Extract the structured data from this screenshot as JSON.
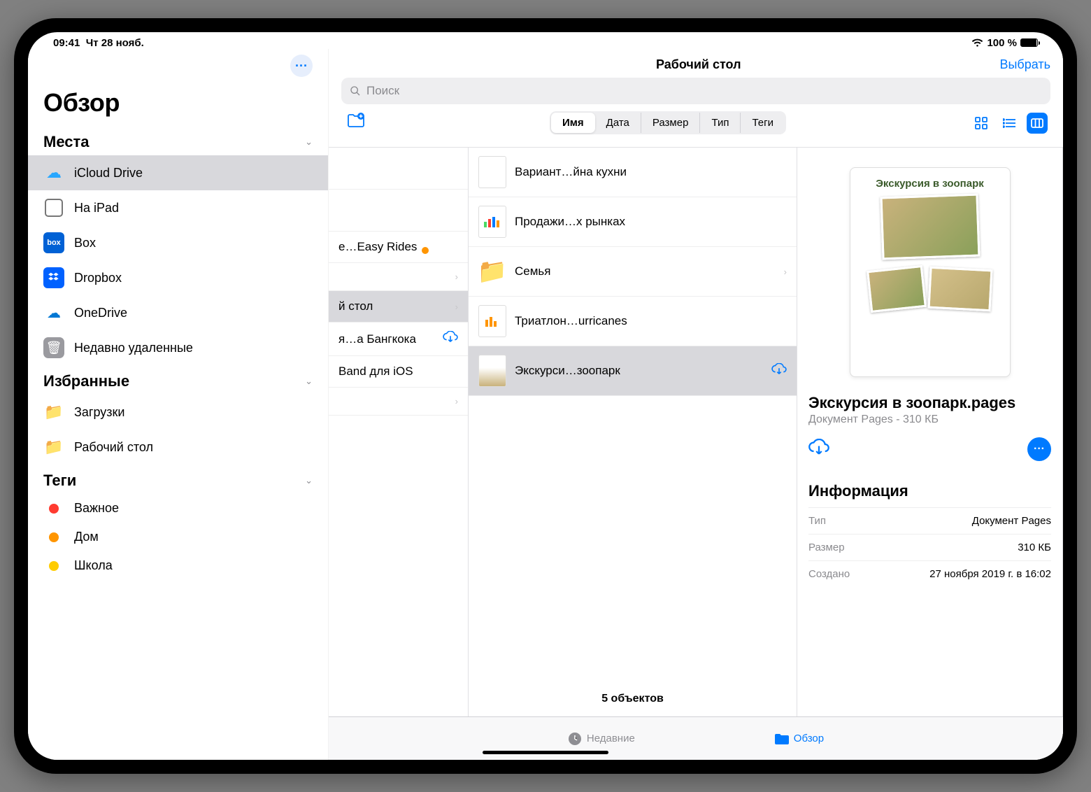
{
  "status": {
    "time": "09:41",
    "date": "Чт 28 нояб.",
    "battery": "100 %"
  },
  "sidebar": {
    "more": "···",
    "title": "Обзор",
    "sec_places": "Места",
    "sec_fav": "Избранные",
    "sec_tags": "Теги",
    "places": [
      {
        "label": "iCloud Drive"
      },
      {
        "label": "На iPad"
      },
      {
        "label": "Box",
        "badge": "box"
      },
      {
        "label": "Dropbox"
      },
      {
        "label": "OneDrive"
      },
      {
        "label": "Недавно удаленные"
      }
    ],
    "favorites": [
      {
        "label": "Загрузки"
      },
      {
        "label": "Рабочий стол"
      }
    ],
    "tags": [
      {
        "label": "Важное",
        "color": "#ff3b30"
      },
      {
        "label": "Дом",
        "color": "#ff9500"
      },
      {
        "label": "Школа",
        "color": "#ffcc00"
      }
    ]
  },
  "main": {
    "title": "Рабочий стол",
    "select": "Выбрать",
    "search_placeholder": "Поиск",
    "sort": {
      "name": "Имя",
      "date": "Дата",
      "size": "Размер",
      "type": "Тип",
      "tags": "Теги"
    }
  },
  "col1": [
    {
      "label": "e…Easy Rides"
    },
    {
      "label": ""
    },
    {
      "label": "й стол",
      "selected": true
    },
    {
      "label": "я…а Бангкока",
      "cloud": true
    },
    {
      "label": "Band для iOS"
    },
    {
      "label": ""
    }
  ],
  "col2": [
    {
      "label": "Вариант…йна кухни",
      "type": "doc"
    },
    {
      "label": "Продажи…х рынках",
      "type": "chart"
    },
    {
      "label": "Семья",
      "type": "folder"
    },
    {
      "label": "Триатлон…urricanes",
      "type": "chart"
    },
    {
      "label": "Экскурси…зоопарк",
      "type": "doc",
      "selected": true,
      "cloud": true
    }
  ],
  "col2_footer": "5 объектов",
  "preview": {
    "doc_title": "Экскурсия в зоопарк",
    "filename": "Экскурсия в зоопарк.pages",
    "subtitle": "Документ Pages - 310 КБ",
    "info_header": "Информация",
    "rows": [
      {
        "k": "Тип",
        "v": "Документ Pages"
      },
      {
        "k": "Размер",
        "v": "310 КБ"
      },
      {
        "k": "Создано",
        "v": "27 ноября 2019 г. в 16:02"
      }
    ]
  },
  "tabbar": {
    "recent": "Недавние",
    "browse": "Обзор"
  }
}
